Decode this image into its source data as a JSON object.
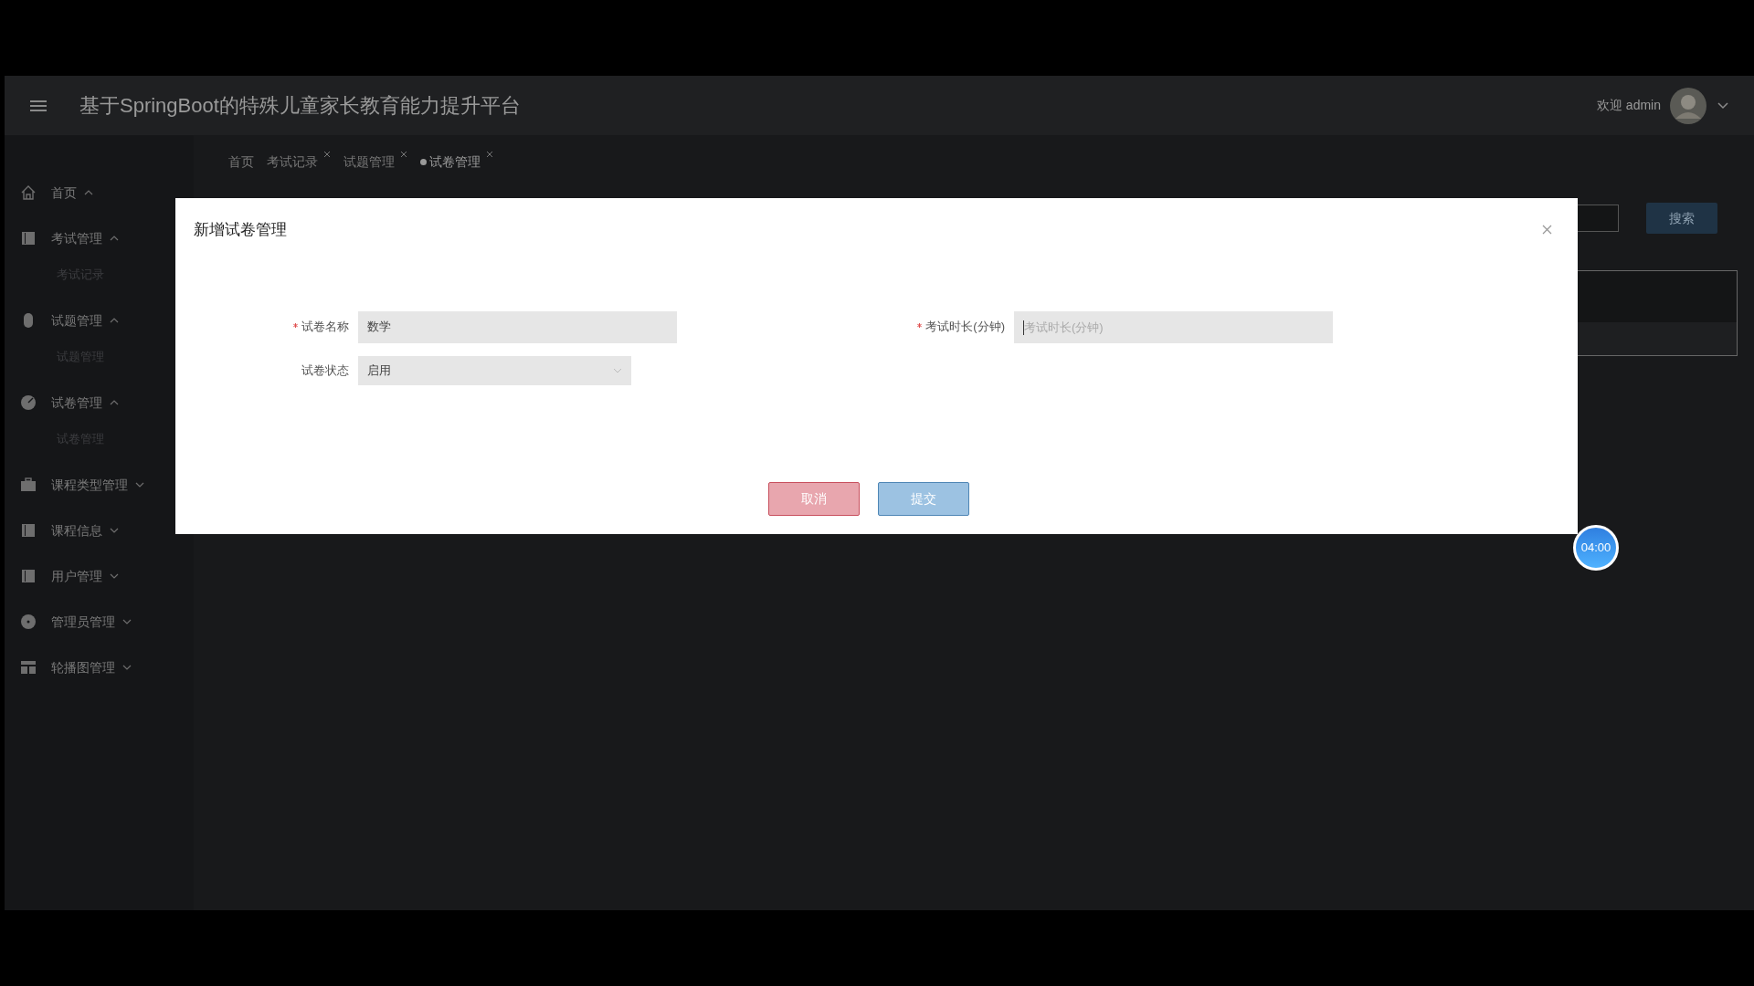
{
  "header": {
    "title": "基于SpringBoot的特殊儿童家长教育能力提升平台",
    "welcome": "欢迎 admin"
  },
  "sidebar": {
    "items": [
      {
        "label": "首页",
        "expanded": true
      },
      {
        "label": "考试管理",
        "expanded": true,
        "children": [
          {
            "label": "考试记录"
          }
        ]
      },
      {
        "label": "试题管理",
        "expanded": true,
        "children": [
          {
            "label": "试题管理"
          }
        ]
      },
      {
        "label": "试卷管理",
        "expanded": true,
        "children": [
          {
            "label": "试卷管理"
          }
        ]
      },
      {
        "label": "课程类型管理",
        "expanded": false
      },
      {
        "label": "课程信息",
        "expanded": false
      },
      {
        "label": "用户管理",
        "expanded": false
      },
      {
        "label": "管理员管理",
        "expanded": false
      },
      {
        "label": "轮播图管理",
        "expanded": false
      }
    ]
  },
  "tabs": [
    {
      "label": "首页",
      "selected": false,
      "closable": false
    },
    {
      "label": "考试记录",
      "selected": false,
      "closable": true
    },
    {
      "label": "试题管理",
      "selected": false,
      "closable": true
    },
    {
      "label": "试卷管理",
      "selected": true,
      "closable": true
    }
  ],
  "search_button": "搜索",
  "dialog": {
    "title": "新增试卷管理",
    "fields": [
      {
        "kind": "text",
        "label": "试卷名称",
        "required": true,
        "value": "数学"
      },
      {
        "kind": "text",
        "label": "考试时长(分钟)",
        "required": true,
        "placeholder": "考试时长(分钟)",
        "focused": true
      },
      {
        "kind": "select",
        "label": "试卷状态",
        "required": false,
        "value": "启用"
      }
    ],
    "buttons": [
      {
        "kind": "cancel",
        "label": "取消"
      },
      {
        "kind": "submit",
        "label": "提交"
      }
    ]
  },
  "timer": "04:00"
}
